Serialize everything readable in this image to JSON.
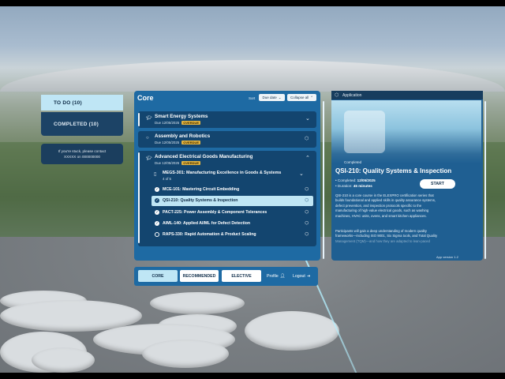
{
  "left_panel": {
    "tabs": [
      {
        "label": "TO DO (10)"
      },
      {
        "label": "COMPLETED (10)"
      }
    ],
    "help_line1": "If you're stuck, please contact",
    "help_line2": "XXXXX on 000000000"
  },
  "main": {
    "title": "Core",
    "sort_label": "Sort",
    "sort_value": "Due date",
    "collapse_label": "Collapse all",
    "courses": [
      {
        "title": "Smart Energy Systems",
        "due": "Due 12/05/2025",
        "badge": "OVERDUE"
      },
      {
        "title": "Assembly and Robotics",
        "due": "Due 12/05/2025",
        "badge": "OVERDUE"
      },
      {
        "title": "Advanced Electrical Goods Manufacturing",
        "due": "Due 12/05/2025",
        "badge": "OVERDUE"
      }
    ],
    "module": {
      "title": "MEGS-301: Manufacturing Excellence in Goods & Systems",
      "progress": "4 of 5"
    },
    "lessons": [
      {
        "label": "MCE-101: Mastering Circuit Embedding"
      },
      {
        "label": "QSI-210: Quality Systems & Inspection"
      },
      {
        "label": "PACT-225: Power Assembly & Component Tolerances"
      },
      {
        "label": "AIML-140: Applied AI/ML for Defect Detection"
      },
      {
        "label": "RAPS-330: Rapid Automation & Product Scaling"
      }
    ]
  },
  "nav": {
    "core": "CORE",
    "recommended": "RECOMMENDED",
    "elective": "ELECTIVE",
    "profile": "Profile",
    "logout": "Logout"
  },
  "app": {
    "header": "Application",
    "status": "Completed",
    "title": "QSI-210: Quality Systems & Inspection",
    "start": "START",
    "completed_label": "• Completed: ",
    "completed_value": "12/05/2025",
    "duration_label": "• Duration: ",
    "duration_value": "45 minutes",
    "desc1_l1": "QSI-210 is a core course in the ELEXPRO certification series that",
    "desc1_l2": "builds foundational and applied skills in quality assurance systems,",
    "desc1_l3": "defect prevention, and inspection protocols specific to the",
    "desc1_l4": "manufacturing of high-value electrical goods, such as washing",
    "desc1_l5": "machines, HVAC units, ovens, and smart kitchen appliances.",
    "desc2_l1": "Participants will gain a deep understanding of modern quality",
    "desc2_l2": "frameworks—including ISO 9001, Six Sigma tools, and Total Quality",
    "desc2_l3": "Management (TQM)—and how they are adapted to lean-paced",
    "version": "App version 1.2"
  },
  "colors": {
    "panel": "#1e6aa3",
    "row": "#13456f",
    "accent_light": "#bfe6f5",
    "overdue": "#e2b33f"
  }
}
